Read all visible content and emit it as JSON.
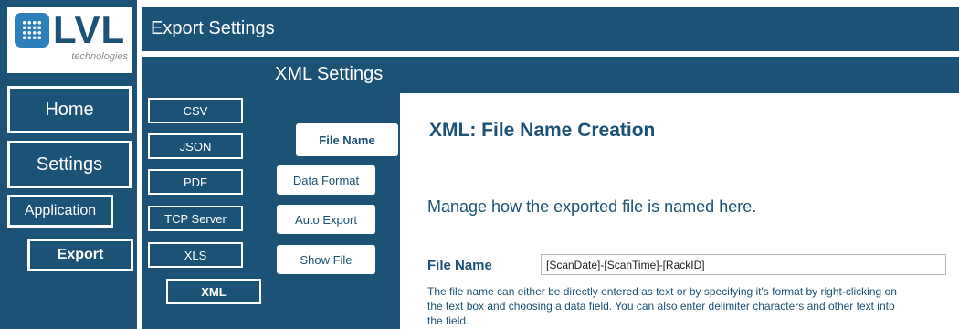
{
  "brand": {
    "logo_name": "LVL",
    "logo_sub": "technologies",
    "primary_color": "#1b5276",
    "logo_icon_color": "#2c7fb8"
  },
  "nav": {
    "home": "Home",
    "settings": "Settings",
    "application": "Application",
    "export": "Export"
  },
  "header": {
    "title": "Export Settings",
    "subtitle": "XML Settings"
  },
  "formats": [
    "CSV",
    "JSON",
    "PDF",
    "TCP Server",
    "XLS",
    "XML"
  ],
  "active_format": "XML",
  "xml_menu": {
    "items": [
      "File Name",
      "Data Format",
      "Auto Export",
      "Show File"
    ],
    "active": "File Name"
  },
  "content": {
    "title": "XML: File Name Creation",
    "description": "Manage how the exported file is named here.",
    "field_label": "File Name",
    "field_value": "[ScanDate]-[ScanTime]-[RackID]",
    "help_text": "The file name can either be directly entered as text or by specifying it's format by right-clicking on the text box and choosing a data field.  You can also enter delimiter characters and other text into the field."
  }
}
